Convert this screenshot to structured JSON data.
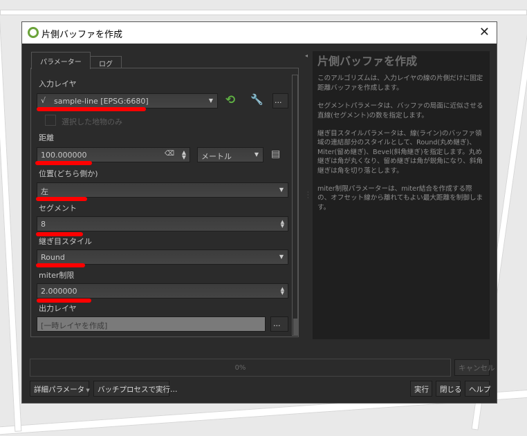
{
  "window": {
    "title": "片側バッファを作成",
    "close": "✕"
  },
  "tabs": [
    {
      "label": "パラメーター",
      "active": true
    },
    {
      "label": "ログ",
      "active": false
    }
  ],
  "params": {
    "input_layer": {
      "label": "入力レイヤ",
      "value": "sample-line [EPSG:6680]",
      "selected_only": "選択した地物のみ",
      "more": "…"
    },
    "distance": {
      "label": "距離",
      "value": "100.000000",
      "unit": "メートル"
    },
    "side": {
      "label": "位置(どちら側か)",
      "value": "左"
    },
    "segments": {
      "label": "セグメント",
      "value": "8"
    },
    "join_style": {
      "label": "継ぎ目スタイル",
      "value": "Round"
    },
    "miter_limit": {
      "label": "miter制限",
      "value": "2.000000"
    },
    "output": {
      "label": "出力レイヤ",
      "placeholder": "[一時レイヤを作成]",
      "more": "…"
    }
  },
  "help": {
    "title": "片側バッファを作成",
    "paragraphs": [
      "このアルゴリズムは、入力レイヤの線の片側だけに固定距離バッファを作成します。",
      "セグメントパラメータは、バッファの局面に近似させる直線(セグメント)の数を指定します。",
      "継ぎ目スタイルパラメータは、線(ライン)のバッファ領域の連結部分のスタイルとして、Round(丸め継ぎ)、Miter(留め継ぎ)、Bevel(斜角継ぎ)を指定します。丸め継ぎは角が丸くなり、留め継ぎは角が鋭角になり、斜角継ぎは角を切り落とします。",
      "miter制限パラメーターは、miter結合を作成する際の、オフセット線から離れてもよい最大距離を制御します。"
    ]
  },
  "progress": {
    "value": 0,
    "text": "0%"
  },
  "buttons": {
    "cancel": "キャンセル",
    "advanced": "詳細パラメータ",
    "batch": "バッチプロセスで実行…",
    "run": "実行",
    "close": "閉じる",
    "help": "ヘルプ"
  },
  "colors": {
    "annotation": "#ff0000",
    "refresh_icon": "#5fb043"
  }
}
